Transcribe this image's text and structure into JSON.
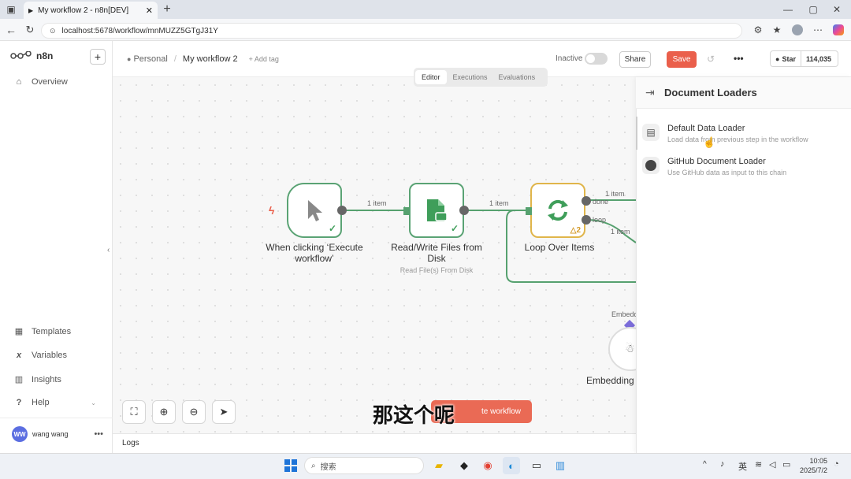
{
  "browser": {
    "tab_title": "My workflow 2 - n8n[DEV]",
    "url": "localhost:5678/workflow/mnMUZZ5GTgJ31Y"
  },
  "sidebar": {
    "brand": "n8n",
    "add_label": "+",
    "overview": "Overview",
    "templates": "Templates",
    "variables": "Variables",
    "insights": "Insights",
    "help": "Help",
    "user_initials": "WW",
    "user_name": "wang wang"
  },
  "header": {
    "breadcrumb_project": "Personal",
    "breadcrumb_sep": "/",
    "workflow_name": "My workflow 2",
    "add_tag": "+ Add tag",
    "status_label": "Inactive",
    "share": "Share",
    "save": "Save",
    "star_label": "Star",
    "star_count": "114,035"
  },
  "tabs": [
    "Editor",
    "Executions",
    "Evaluations"
  ],
  "nodes": {
    "trigger": {
      "title_line1": "When clicking ‘Execute",
      "title_line2": "workflow’"
    },
    "readwrite": {
      "title_line1": "Read/Write Files from",
      "title_line2": "Disk",
      "subtitle": "Read File(s) From Disk"
    },
    "loop": {
      "title": "Loop Over Items",
      "badge": "2",
      "out_done": "done",
      "out_loop": "loop"
    },
    "embeddings": {
      "title": "Embedding",
      "port_label": "Embedd"
    }
  },
  "connections": {
    "label1": "1 item",
    "label2": "1 item",
    "label3": "1 item",
    "label4": "1 item"
  },
  "toolbar": {
    "execute_label": "te workflow"
  },
  "logs_label": "Logs",
  "subtitle_overlay": "那这个呢",
  "panel": {
    "title": "Document Loaders",
    "items": [
      {
        "title": "Default Data Loader",
        "desc": "Load data from previous step in the workflow",
        "icon": "document-icon"
      },
      {
        "title": "GitHub Document Loader",
        "desc": "Use GitHub data as input to this chain",
        "icon": "github-icon"
      }
    ]
  },
  "taskbar": {
    "search_label": "搜索",
    "lang": "英",
    "time": "10:05",
    "date": "2025/7/2"
  },
  "colors": {
    "node_border": "#5aa374",
    "loop_border": "#e0b54a",
    "save_bg": "#ea5f4b",
    "execute_bg": "#ea6a55",
    "connection": "#56a16f"
  }
}
